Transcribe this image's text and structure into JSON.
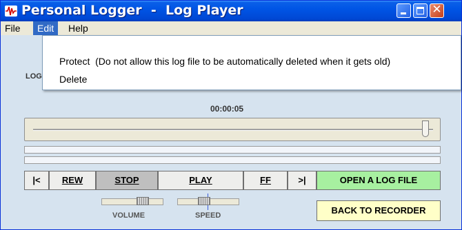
{
  "window": {
    "title": "Personal Logger  -  Log Player"
  },
  "menubar": {
    "file": "File",
    "edit": "Edit",
    "help": "Help"
  },
  "edit_menu": {
    "items": [
      "Protect  (Do not allow this log file to be automatically deleted when it gets old)",
      "Delete"
    ]
  },
  "log_label": "LOG",
  "time_display": "00:00:05",
  "seek": {
    "position_fraction": 0.98
  },
  "controls": {
    "first": "|<",
    "rew": "REW",
    "stop": "STOP",
    "play": "PLAY",
    "ff": "FF",
    "last": ">|",
    "open": "OPEN A LOG FILE",
    "back": "BACK TO RECORDER"
  },
  "volume": {
    "label": "VOLUME",
    "level_fraction": 0.8
  },
  "speed": {
    "label": "SPEED",
    "level_fraction": 0.5
  },
  "colors": {
    "titlebar": "#0055e5",
    "menu_highlight": "#316ac5",
    "open_button": "#a7f0a0",
    "back_button": "#ffffc8",
    "window_bg": "#d6e3ef"
  },
  "icons": {
    "app": "waveform-icon",
    "minimize": "minimize-icon",
    "maximize": "maximize-icon",
    "close": "close-icon"
  }
}
